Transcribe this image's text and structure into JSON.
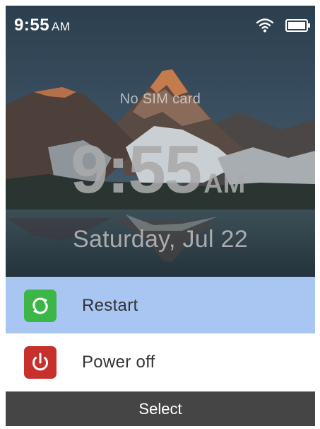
{
  "status_bar": {
    "time": "9:55",
    "ampm": "AM",
    "wifi_icon": "wifi-icon",
    "battery_icon": "battery-icon"
  },
  "lock_screen": {
    "sim_status": "No SIM card",
    "clock_time": "9:55",
    "clock_ampm": "AM",
    "date": "Saturday, Jul 22"
  },
  "power_menu": {
    "items": [
      {
        "label": "Restart",
        "icon": "restart-icon",
        "icon_color": "#3db548",
        "selected": true
      },
      {
        "label": "Power off",
        "icon": "power-icon",
        "icon_color": "#c8302c",
        "selected": false
      }
    ],
    "selected_color": "#a9c6f3"
  },
  "softkeys": {
    "center": "Select"
  }
}
